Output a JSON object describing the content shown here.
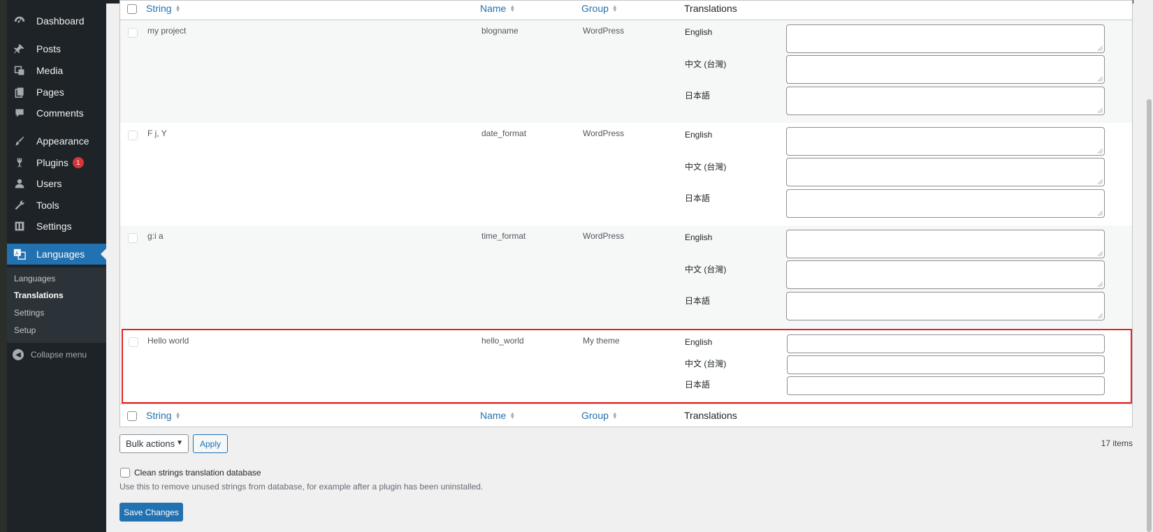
{
  "sidebar": {
    "items": [
      {
        "label": "Dashboard",
        "icon": "dashboard-icon"
      },
      {
        "label": "Posts",
        "icon": "pin-icon"
      },
      {
        "label": "Media",
        "icon": "media-icon"
      },
      {
        "label": "Pages",
        "icon": "pages-icon"
      },
      {
        "label": "Comments",
        "icon": "comments-icon"
      },
      {
        "label": "Appearance",
        "icon": "brush-icon"
      },
      {
        "label": "Plugins",
        "icon": "plugin-icon",
        "badge": "1"
      },
      {
        "label": "Users",
        "icon": "users-icon"
      },
      {
        "label": "Tools",
        "icon": "wrench-icon"
      },
      {
        "label": "Settings",
        "icon": "settings-icon"
      },
      {
        "label": "Languages",
        "icon": "translate-icon"
      }
    ],
    "submenu": [
      "Languages",
      "Translations",
      "Settings",
      "Setup"
    ],
    "collapse_label": "Collapse menu"
  },
  "table": {
    "columns": {
      "string": "String",
      "name": "Name",
      "group": "Group",
      "translations": "Translations"
    },
    "languages": [
      "English",
      "中文 (台灣)",
      "日本語"
    ],
    "rows": [
      {
        "string": "my project",
        "name": "blogname",
        "group": "WordPress"
      },
      {
        "string": "F j, Y",
        "name": "date_format",
        "group": "WordPress"
      },
      {
        "string": "g:i a",
        "name": "time_format",
        "group": "WordPress"
      },
      {
        "string": "Hello world",
        "name": "hello_world",
        "group": "My theme"
      }
    ]
  },
  "footer": {
    "bulk_actions": "Bulk actions",
    "apply": "Apply",
    "items_count": "17 items",
    "clean_label": "Clean strings translation database",
    "clean_desc": "Use this to remove unused strings from database, for example after a plugin has been uninstalled.",
    "save": "Save Changes"
  },
  "colors": {
    "accent": "#2271b1",
    "sidebar": "#1d2327",
    "highlight": "#e02424",
    "badge": "#d63638"
  }
}
